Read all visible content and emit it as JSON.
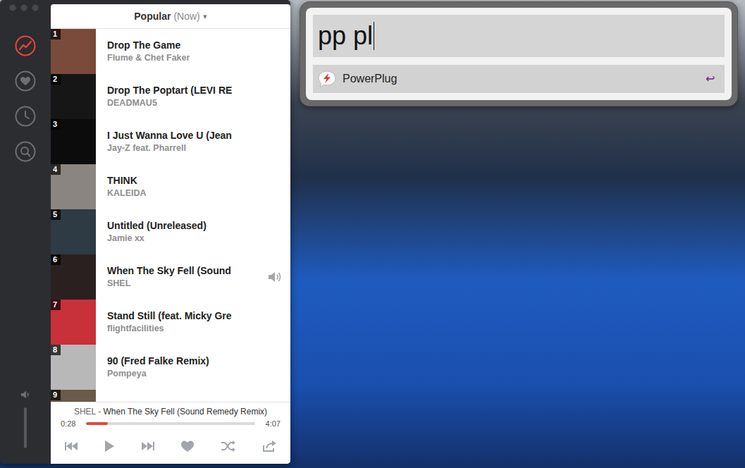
{
  "app": {
    "header": {
      "title": "Popular",
      "subtitle": "(Now)",
      "arrow": "▾"
    },
    "sidebar": {
      "items": [
        {
          "kind": "trending",
          "selected": true
        },
        {
          "kind": "heart",
          "selected": false
        },
        {
          "kind": "clock",
          "selected": false
        },
        {
          "kind": "search",
          "selected": false
        }
      ]
    },
    "volume": {
      "level": 1
    },
    "tracks": [
      {
        "rank": "1",
        "title": "Drop The Game",
        "artist": "Flume & Chet Faker",
        "playing": false,
        "color": "#7a4a3a"
      },
      {
        "rank": "2",
        "title": "Drop The Poptart (LEVI RE",
        "artist": "DEADMAU5",
        "playing": false,
        "color": "#161616"
      },
      {
        "rank": "3",
        "title": "I Just Wanna Love U (Jean",
        "artist": "Jay-Z feat. Pharrell",
        "playing": false,
        "color": "#0c0c0c"
      },
      {
        "rank": "4",
        "title": "THINK",
        "artist": "KALEIDA",
        "playing": false,
        "color": "#8a8580"
      },
      {
        "rank": "5",
        "title": "Untitled (Unreleased)",
        "artist": "Jamie xx",
        "playing": false,
        "color": "#2e3a44"
      },
      {
        "rank": "6",
        "title": "When The Sky Fell (Sound",
        "artist": "SHEL",
        "playing": true,
        "color": "#2a2020"
      },
      {
        "rank": "7",
        "title": "Stand Still (feat. Micky Gre",
        "artist": "flightfacilities",
        "playing": false,
        "color": "#c8303a"
      },
      {
        "rank": "8",
        "title": "90 (Fred Falke Remix)",
        "artist": "Pompeya",
        "playing": false,
        "color": "#b8b8b8"
      },
      {
        "rank": "9",
        "title": "",
        "artist": "",
        "playing": false,
        "color": "#6a5a4a"
      }
    ],
    "player": {
      "artist": "SHEL",
      "separator": " - ",
      "title": "When The Sky Fell (Sound Remedy Remix)",
      "elapsed": "0:28",
      "duration": "4:07",
      "level": 0.13,
      "liked": false
    }
  },
  "launcher": {
    "query": "pp pl",
    "results": [
      {
        "label": "PowerPlug",
        "hint": "↩",
        "selected": true
      }
    ]
  }
}
